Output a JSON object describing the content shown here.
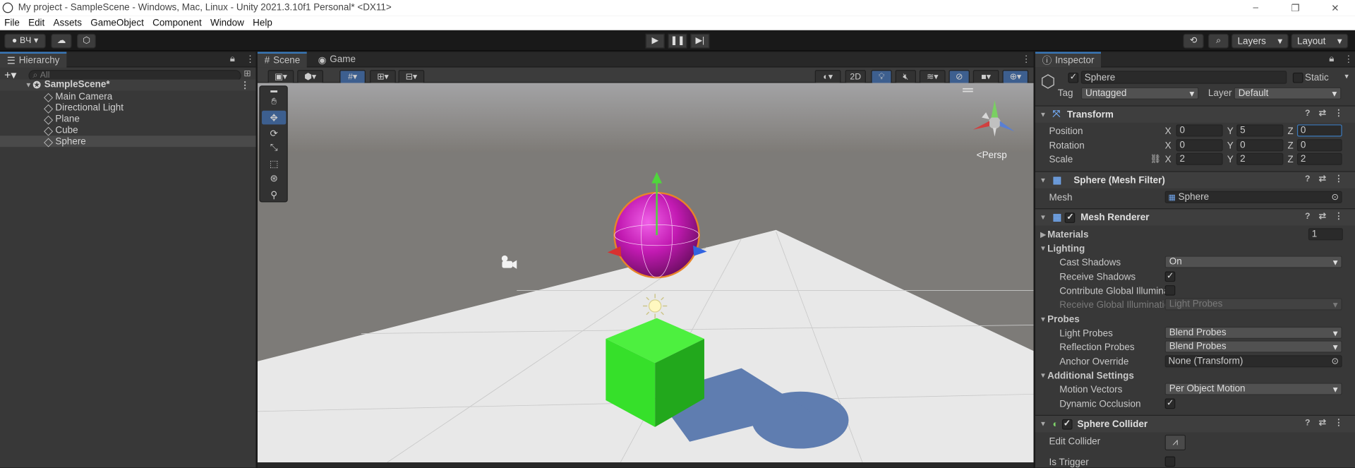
{
  "window": {
    "title": "My project - SampleScene - Windows, Mac, Linux - Unity 2021.3.10f1 Personal* <DX11>",
    "controls": [
      "–",
      "❐",
      "✕"
    ]
  },
  "menu": [
    "File",
    "Edit",
    "Assets",
    "GameObject",
    "Component",
    "Window",
    "Help"
  ],
  "toolbar": {
    "account": "BЧ",
    "layers": "Layers",
    "layout": "Layout",
    "history_icon": "history-icon",
    "search_icon": "search-icon"
  },
  "hierarchy": {
    "title": "Hierarchy",
    "search_placeholder": "All",
    "scene": "SampleScene*",
    "items": [
      "Main Camera",
      "Directional Light",
      "Plane",
      "Cube",
      "Sphere"
    ],
    "selected": "Sphere"
  },
  "scene": {
    "tabs": [
      "Scene",
      "Game"
    ],
    "mode_2d": "2D",
    "persp": "Persp",
    "colors": {
      "sky": "#8c8985",
      "ground": "#e8e8e8",
      "sphere": "#c21ab2",
      "cube": "#33e62e",
      "shadow": "#5f7db0"
    }
  },
  "inspector": {
    "title": "Inspector",
    "object": {
      "name": "Sphere",
      "static": "Static",
      "tag_label": "Tag",
      "tag": "Untagged",
      "layer_label": "Layer",
      "layer": "Default"
    },
    "transform": {
      "title": "Transform",
      "rows": [
        {
          "label": "Position",
          "x": "0",
          "y": "5",
          "z": "0"
        },
        {
          "label": "Rotation",
          "x": "0",
          "y": "0",
          "z": "0"
        },
        {
          "label": "Scale",
          "x": "2",
          "y": "2",
          "z": "2"
        }
      ]
    },
    "mesh_filter": {
      "title": "Sphere (Mesh Filter)",
      "mesh_label": "Mesh",
      "mesh": "Sphere"
    },
    "mesh_renderer": {
      "title": "Mesh Renderer",
      "materials_label": "Materials",
      "materials_count": "1",
      "lighting_label": "Lighting",
      "cast_shadows_label": "Cast Shadows",
      "cast_shadows": "On",
      "receive_shadows_label": "Receive Shadows",
      "contribute_gi_label": "Contribute Global Illuminat",
      "receive_gi_label": "Receive Global Illuminatio",
      "receive_gi": "Light Probes",
      "probes_label": "Probes",
      "light_probes_label": "Light Probes",
      "light_probes": "Blend Probes",
      "reflection_probes_label": "Reflection Probes",
      "reflection_probes": "Blend Probes",
      "anchor_override_label": "Anchor Override",
      "anchor_override": "None (Transform)",
      "additional_label": "Additional Settings",
      "motion_vectors_label": "Motion Vectors",
      "motion_vectors": "Per Object Motion",
      "dynamic_occlusion_label": "Dynamic Occlusion"
    },
    "sphere_collider": {
      "title": "Sphere Collider",
      "edit_collider_label": "Edit Collider",
      "is_trigger_label": "Is Trigger"
    }
  }
}
